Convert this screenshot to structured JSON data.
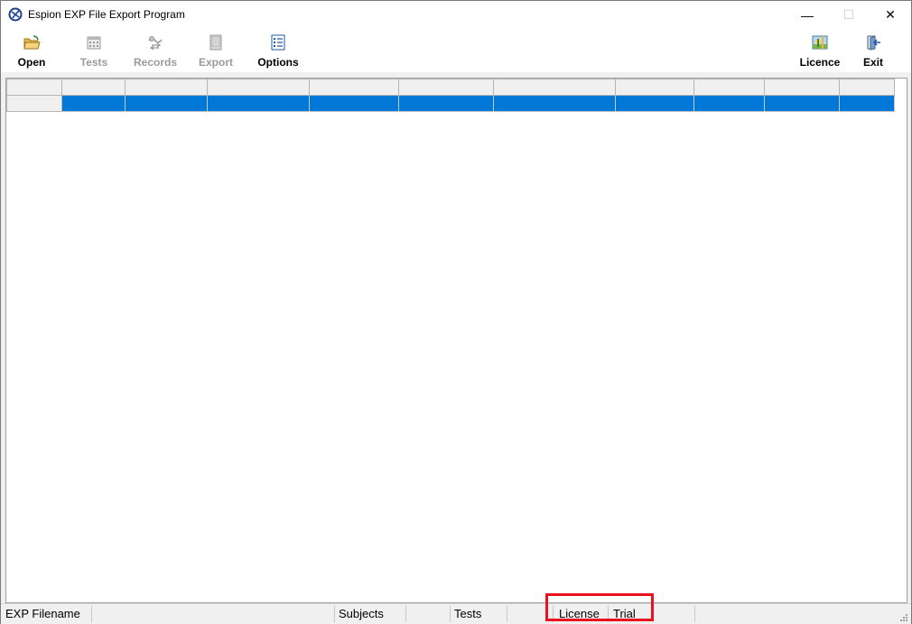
{
  "window": {
    "title": "Espion EXP File Export Program",
    "controls": {
      "minimize": "—",
      "maximize": "☐",
      "close": "✕"
    }
  },
  "toolbar": {
    "buttons": [
      {
        "label": "Open",
        "icon": "open-folder-icon",
        "enabled": true
      },
      {
        "label": "Tests",
        "icon": "calendar-icon",
        "enabled": false
      },
      {
        "label": "Records",
        "icon": "records-icon",
        "enabled": false
      },
      {
        "label": "Export",
        "icon": "export-document-icon",
        "enabled": false
      },
      {
        "label": "Options",
        "icon": "options-list-icon",
        "enabled": true
      },
      {
        "label": "Licence",
        "icon": "licence-icon",
        "enabled": true
      },
      {
        "label": "Exit",
        "icon": "exit-door-icon",
        "enabled": true
      }
    ]
  },
  "grid": {
    "column_count": 10,
    "selected_row": 1
  },
  "statusbar": {
    "filename_label": "EXP Filename",
    "filename_value": "",
    "subjects_label": "Subjects",
    "subjects_value": "",
    "tests_label": "Tests",
    "tests_value": "",
    "license_label": "License",
    "license_value": "Trial"
  },
  "colors": {
    "selection": "#0078d7",
    "highlight_box": "#e8131f"
  }
}
